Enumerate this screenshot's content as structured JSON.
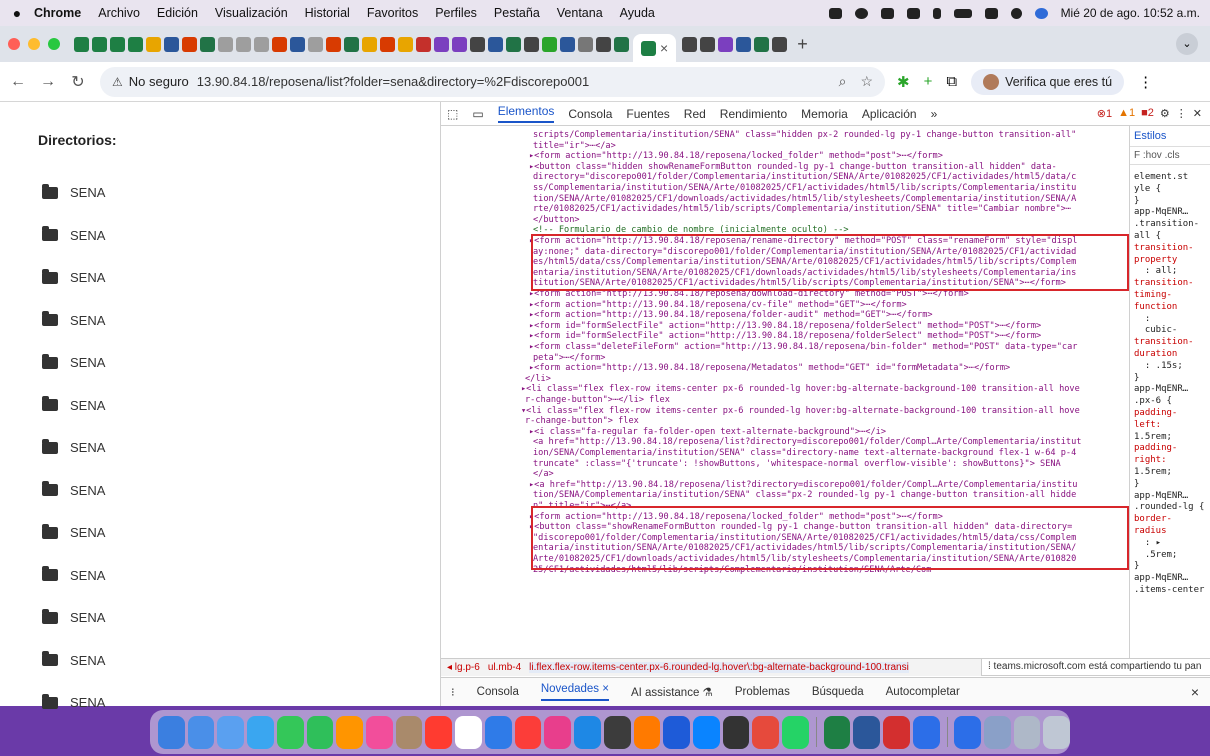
{
  "menubar": {
    "app": "Chrome",
    "items": [
      "Archivo",
      "Edición",
      "Visualización",
      "Historial",
      "Favoritos",
      "Perfiles",
      "Pestaña",
      "Ventana",
      "Ayuda"
    ],
    "datetime": "Mié 20 de ago. 10:52 a.m."
  },
  "tabs": {
    "active_close": "×",
    "new_tab": "+"
  },
  "toolbar": {
    "security_label": "No seguro",
    "url": "13.90.84.18/reposena/list?folder=sena&directory=%2Fdiscorepo001",
    "verify_label": "Verifica que eres tú"
  },
  "page": {
    "heading": "Directorios:",
    "directories": [
      "SENA",
      "SENA",
      "SENA",
      "SENA",
      "SENA",
      "SENA",
      "SENA",
      "SENA",
      "SENA",
      "SENA",
      "SENA",
      "SENA",
      "SENA"
    ]
  },
  "devtools": {
    "tabs": [
      "Elementos",
      "Consola",
      "Fuentes",
      "Red",
      "Rendimiento",
      "Memoria",
      "Aplicación",
      "»"
    ],
    "badges": {
      "errors": "1",
      "warnings": "1",
      "issues": "2"
    },
    "code_lines": [
      "scripts/Complementaria/institution/SENA\" class=\"hidden px-2 rounded-lg py-1 change-button transition-all\"",
      "title=\"ir\">⋯</a>",
      "▸<form action=\"http://13.90.84.18/reposena/locked_folder\" method=\"post\">⋯</form>",
      "▸<button class=\"hidden showRenameFormButton rounded-lg py-1 change-button transition-all hidden\" data-",
      "directory=\"discorepo001/folder/Complementaria/institution/SENA/Arte/01082025/CF1/actividades/html5/data/c",
      "ss/Complementaria/institution/SENA/Arte/01082025/CF1/actividades/html5/lib/scripts/Complementaria/institu",
      "tion/SENA/Arte/01082025/CF1/downloads/actividades/html5/lib/stylesheets/Complementaria/institution/SENA/A",
      "rte/01082025/CF1/actividades/html5/lib/scripts/Complementaria/institution/SENA\" title=\"Cambiar nombre\">⋯",
      "</button>",
      "<!-- Formulario de cambio de nombre (inicialmente oculto) -->",
      "▸<form action=\"http://13.90.84.18/reposena/rename-directory\" method=\"POST\" class=\"renameForm\" style=\"displ",
      "ay:none;\" data-directory=\"discorepo001/folder/Complementaria/institution/SENA/Arte/01082025/CF1/actividad",
      "es/html5/data/css/Complementaria/institution/SENA/Arte/01082025/CF1/actividades/html5/lib/scripts/Complem",
      "entaria/institution/SENA/Arte/01082025/CF1/downloads/actividades/html5/lib/stylesheets/Complementaria/ins",
      "titution/SENA/Arte/01082025/CF1/actividades/html5/lib/scripts/Complementaria/institution/SENA\">⋯</form>",
      "▸<form action=\"http://13.90.84.18/reposena/download-directory\" method=\"POST\">⋯</form>",
      "▸<form action=\"http://13.90.84.18/reposena/cv-file\" method=\"GET\">⋯</form>",
      "▸<form action=\"http://13.90.84.18/reposena/folder-audit\" method=\"GET\">⋯</form>",
      "▸<form id=\"formSelectFile\" action=\"http://13.90.84.18/reposena/folderSelect\" method=\"POST\">⋯</form>",
      "▸<form id=\"formSelectFile\" action=\"http://13.90.84.18/reposena/folderSelect\" method=\"POST\">⋯</form>",
      "▸<form class=\"deleteFileForm\" action=\"http://13.90.84.18/reposena/bin-folder\" method=\"POST\" data-type=\"car",
      "peta\">⋯</form>",
      "▸<form action=\"http://13.90.84.18/reposena/Metadatos\" method=\"GET\" id=\"formMetadata\">⋯</form>",
      "</li>",
      "▸<li class=\"flex flex-row items-center px-6 rounded-lg hover:bg-alternate-background-100 transition-all hove",
      "r-change-button\">⋯</li> flex",
      "▾<li class=\"flex flex-row items-center px-6 rounded-lg hover:bg-alternate-background-100 transition-all hove",
      "r-change-button\"> flex",
      "▸<i class=\"fa-regular fa-folder-open text-alternate-background\">⋯</i>",
      "<a href=\"http://13.90.84.18/reposena/list?directory=discorepo001/folder/Compl…Arte/Complementaria/institut",
      "ion/SENA/Complementaria/institution/SENA\" class=\"directory-name text-alternate-background flex-1 w-64 p-4",
      "truncate\" :class=\"{'truncate': !showButtons, 'whitespace-normal overflow-visible': showButtons}\"> SENA",
      "</a>",
      "▸<a href=\"http://13.90.84.18/reposena/list?directory=discorepo001/folder/Compl…Arte/Complementaria/institu",
      "tion/SENA/Complementaria/institution/SENA\" class=\"px-2 rounded-lg py-1 change-button transition-all hidde",
      "n\" title=\"ir\">⋯</a>",
      "▸<form action=\"http://13.90.84.18/reposena/locked_folder\" method=\"post\">⋯</form>",
      "▸<button class=\"showRenameFormButton rounded-lg py-1 change-button transition-all hidden\" data-directory=",
      "\"discorepo001/folder/Complementaria/institution/SENA/Arte/01082025/CF1/actividades/html5/data/css/Complem",
      "entaria/institution/SENA/Arte/01082025/CF1/actividades/html5/lib/scripts/Complementaria/institution/SENA/",
      "Arte/01082025/CF1/downloads/actividades/html5/lib/stylesheets/Complementaria/institution/SENA/Arte/010820",
      "25/CF1/actividades/html5/lib/scripts/Complementaria/institution/SENA/Arte/Com"
    ],
    "styles": {
      "tab": "Estilos",
      "filter": "F :hov .cls",
      "rules": [
        "element.st",
        "yle {",
        "}",
        "app-MqENR…",
        ".transition-",
        "all {",
        "transition-",
        "property",
        "  : all;",
        "transition-",
        "timing-",
        "function",
        "  :",
        "  cubic-",
        "transition-",
        "duration",
        "  : .15s;",
        "}",
        "app-MqENR…",
        ".px-6 {",
        "padding-",
        "left:",
        "1.5rem;",
        "padding-",
        "right:",
        "1.5rem;",
        "}",
        "app-MqENR…",
        ".rounded-lg {",
        "border-",
        "radius",
        "  : ▸",
        "  .5rem;",
        "}",
        "app-MqENR…",
        ".items-center"
      ]
    },
    "breadcrumbs": [
      "◂  lg.p-6",
      "ul.mb-4",
      "li.flex.flex-row.items-center.px-6.rounded-lg.hover\\:bg-alternate-background-100.transi"
    ],
    "share_notice": "⁞ teams.microsoft.com está compartiendo tu pan",
    "drawer_tabs": [
      "⁝",
      "Consola",
      "Novedades ×",
      "AI assistance ⚗",
      "Problemas",
      "Búsqueda",
      "Autocompletar"
    ],
    "drawer_close": "×"
  }
}
